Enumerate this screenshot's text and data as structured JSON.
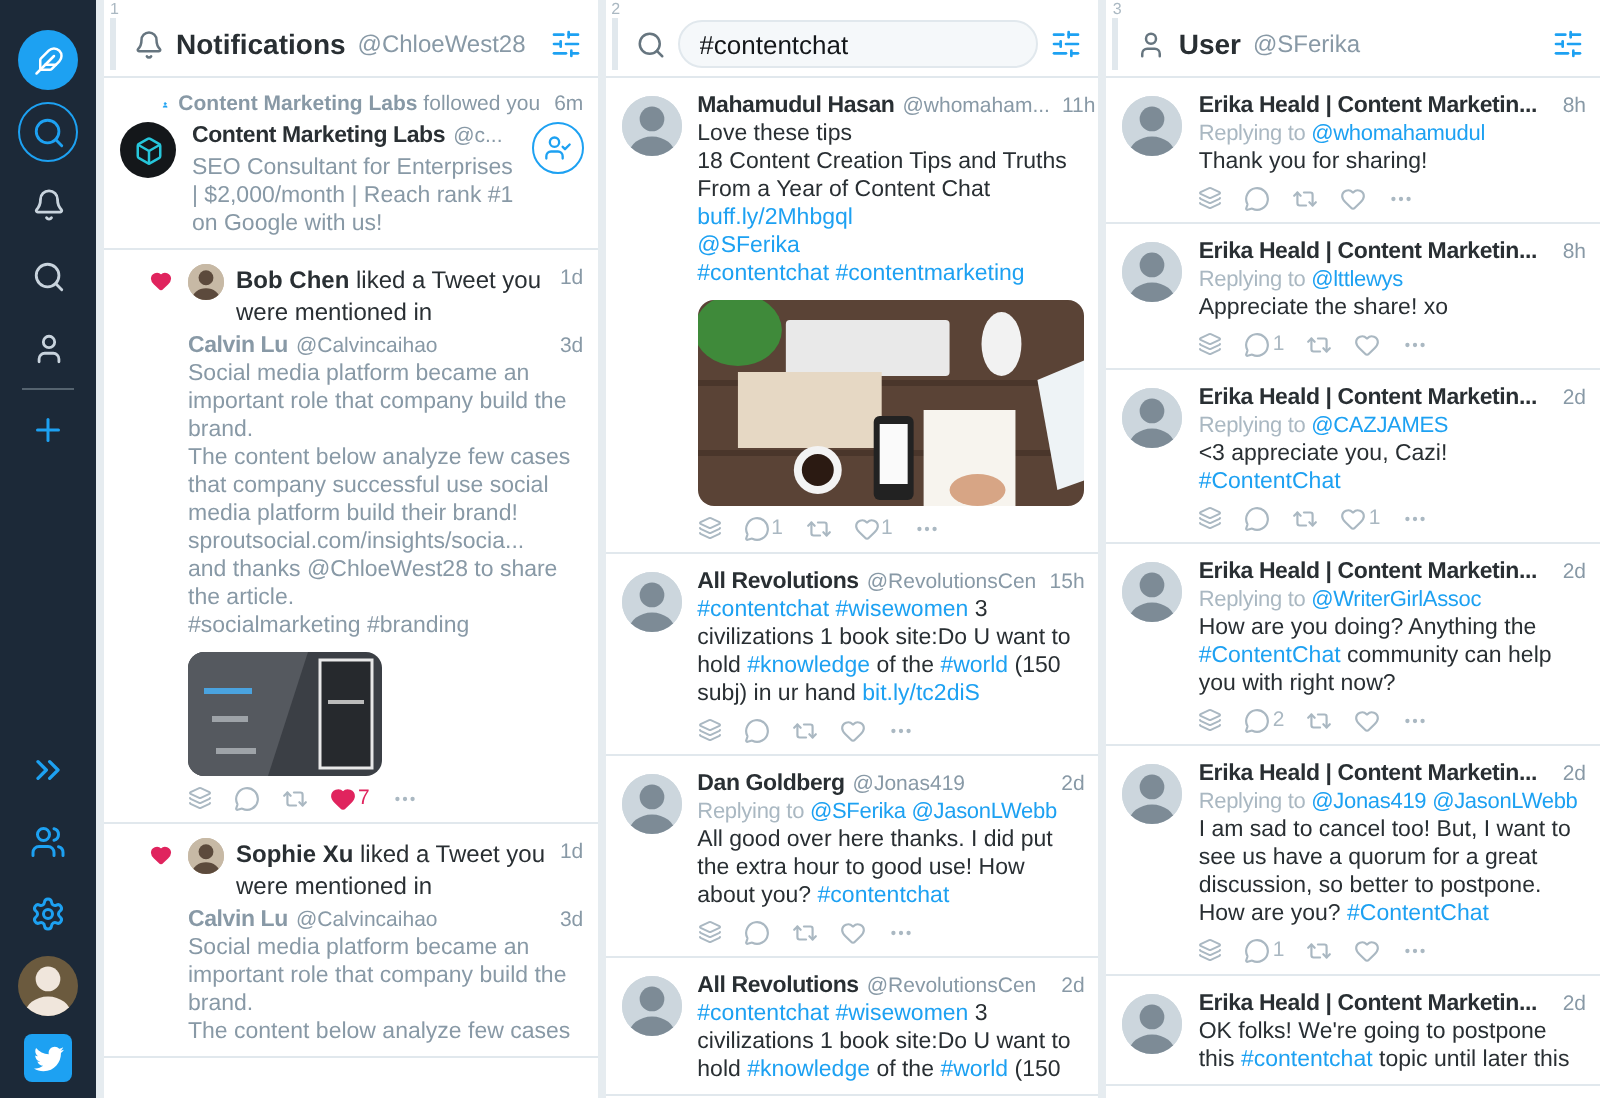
{
  "sidebar": {
    "nav": [
      {
        "selected": false
      },
      {
        "selected": true
      },
      {
        "selected": false
      },
      {
        "selected": false
      },
      {
        "selected": false
      },
      {
        "selected": false
      }
    ]
  },
  "columns": [
    {
      "number": "1",
      "kind": "notifications",
      "title": "Notifications",
      "handle": "@ChloeWest28",
      "items": [
        {
          "kind": "follow",
          "line": "**Content Marketing Labs** followed you",
          "time": "6m",
          "account": {
            "name": "Content Marketing Labs",
            "handle": "@c...",
            "bio": "SEO Consultant for Enterprises | $2,000/month | Reach rank #1 on Google with us!"
          }
        },
        {
          "kind": "like",
          "line": "**Bob Chen** liked a Tweet you were mentioned in",
          "time": "1d",
          "tweet": {
            "name": "Calvin Lu",
            "handle": "@Calvincaihao",
            "time": "3d",
            "text": [
              [
                {
                  "text": "Social media platform became an important role that company build the brand.",
                  "link": false
                }
              ],
              [
                {
                  "text": "The content below analyze few cases that company successful use social media platform build their brand!",
                  "link": false
                }
              ],
              [
                {
                  "text": "sproutsocial.com/insights/socia...",
                  "link": false
                }
              ],
              [
                {
                  "text": "and thanks @ChloeWest28 to share the article.",
                  "link": false
                }
              ],
              [
                {
                  "text": "#socialmarketing #branding",
                  "link": false
                }
              ]
            ],
            "media": {
              "kind": "picture"
            },
            "actions": {
              "likes": "7",
              "liked": true
            }
          }
        },
        {
          "kind": "like",
          "line": "**Sophie Xu** liked a Tweet you were mentioned in",
          "time": "1d",
          "tweet": {
            "name": "Calvin Lu",
            "handle": "@Calvincaihao",
            "time": "3d",
            "text": [
              [
                {
                  "text": "Social media platform became an important role that company build the brand.",
                  "link": false
                }
              ],
              [
                {
                  "text": "The content below analyze few cases",
                  "link": false
                }
              ]
            ]
          }
        }
      ]
    },
    {
      "number": "2",
      "kind": "search",
      "query": "#contentchat",
      "items": [
        {
          "kind": "tweet",
          "name": "Mahamudul Hasan",
          "handle": "@whomaham...",
          "time": "11h",
          "text": [
            [
              {
                "text": "Love these tips",
                "link": false
              }
            ],
            [
              {
                "text": "18 Content Creation Tips and Truths From a Year of Content Chat",
                "link": false
              }
            ],
            [
              {
                "text": "buff.ly/2Mhbgql",
                "link": true
              }
            ],
            [
              {
                "text": "@SFerika",
                "link": true
              }
            ],
            [
              {
                "text": "#contentchat",
                "link": true
              },
              {
                "text": "#contentmarketing",
                "link": true
              }
            ]
          ],
          "media": {
            "kind": "picture"
          },
          "actions": {
            "replies": "1",
            "likes": "1",
            "liked": false
          }
        },
        {
          "kind": "tweet",
          "name": "All Revolutions",
          "handle": "@RevolutionsCen",
          "time": "15h",
          "text": [
            [
              {
                "text": "#contentchat",
                "link": true
              },
              {
                "text": "#wisewomen",
                "link": true
              },
              {
                "text": "3 civilizations 1 book site:Do U want to hold",
                "link": false
              },
              {
                "text": "#knowledge",
                "link": true
              },
              {
                "text": "of the",
                "link": false
              },
              {
                "text": "#world",
                "link": true
              },
              {
                "text": "(150 subj) in ur hand",
                "link": false
              },
              {
                "text": "bit.ly/tc2diS",
                "link": true
              }
            ]
          ],
          "actions": {
            "liked": false
          }
        },
        {
          "kind": "tweet",
          "name": "Dan Goldberg",
          "handle": "@Jonas419",
          "time": "2d",
          "reply": {
            "label": "Replying to",
            "handles": [
              "@SFerika",
              "@JasonLWebb"
            ]
          },
          "text": [
            [
              {
                "text": "All good over here thanks. I did put the extra hour to good use! How about you?",
                "link": false
              },
              {
                "text": "#contentchat",
                "link": true
              }
            ]
          ],
          "actions": {
            "liked": false
          }
        },
        {
          "kind": "tweet",
          "name": "All Revolutions",
          "handle": "@RevolutionsCen",
          "time": "2d",
          "text": [
            [
              {
                "text": "#contentchat",
                "link": true
              },
              {
                "text": "#wisewomen",
                "link": true
              },
              {
                "text": "3 civilizations 1 book site:Do U want to hold",
                "link": false
              },
              {
                "text": "#knowledge",
                "link": true
              },
              {
                "text": "of the",
                "link": false
              },
              {
                "text": "#world",
                "link": true
              },
              {
                "text": "(150",
                "link": false
              }
            ]
          ]
        }
      ]
    },
    {
      "number": "3",
      "kind": "user",
      "title": "User",
      "handle": "@SFerika",
      "items": [
        {
          "kind": "tweet",
          "name": "Erika Heald | Content Marketin...",
          "time": "8h",
          "reply": {
            "label": "Replying to",
            "handles": [
              "@whomahamudul"
            ]
          },
          "text": [
            [
              {
                "text": "Thank you for sharing!",
                "link": false
              }
            ]
          ],
          "actions": {
            "liked": false
          }
        },
        {
          "kind": "tweet",
          "name": "Erika Heald | Content Marketin...",
          "time": "8h",
          "reply": {
            "label": "Replying to",
            "handles": [
              "@lttlewys"
            ]
          },
          "text": [
            [
              {
                "text": "Appreciate the share! xo",
                "link": false
              }
            ]
          ],
          "actions": {
            "replies": "1",
            "liked": false
          }
        },
        {
          "kind": "tweet",
          "name": "Erika Heald | Content Marketin...",
          "time": "2d",
          "reply": {
            "label": "Replying to",
            "handles": [
              "@CAZJAMES"
            ]
          },
          "text": [
            [
              {
                "text": "<3 appreciate you, Cazi!",
                "link": false
              }
            ],
            [
              {
                "text": "#ContentChat",
                "link": true
              }
            ]
          ],
          "actions": {
            "likes": "1",
            "liked": false
          }
        },
        {
          "kind": "tweet",
          "name": "Erika Heald | Content Marketin...",
          "time": "2d",
          "reply": {
            "label": "Replying to",
            "handles": [
              "@WriterGirlAssoc"
            ]
          },
          "text": [
            [
              {
                "text": "How are you doing? Anything the",
                "link": false
              },
              {
                "text": "#ContentChat",
                "link": true
              },
              {
                "text": "community can help you with right now?",
                "link": false
              }
            ]
          ],
          "actions": {
            "replies": "2",
            "liked": false
          }
        },
        {
          "kind": "tweet",
          "name": "Erika Heald | Content Marketin...",
          "time": "2d",
          "reply": {
            "label": "Replying to",
            "handles": [
              "@Jonas419",
              "@JasonLWebb"
            ]
          },
          "text": [
            [
              {
                "text": "I am sad to cancel too! But, I want to see us have a quorum for a great discussion, so better to postpone. How are you?",
                "link": false
              },
              {
                "text": "#ContentChat",
                "link": true
              }
            ]
          ],
          "actions": {
            "replies": "1",
            "liked": false
          }
        },
        {
          "kind": "tweet",
          "name": "Erika Heald | Content Marketin...",
          "time": "2d",
          "text": [
            [
              {
                "text": "OK folks! We're going to postpone this",
                "link": false
              },
              {
                "text": "#contentchat",
                "link": true
              },
              {
                "text": "topic until later this",
                "link": false
              }
            ]
          ]
        }
      ]
    }
  ]
}
